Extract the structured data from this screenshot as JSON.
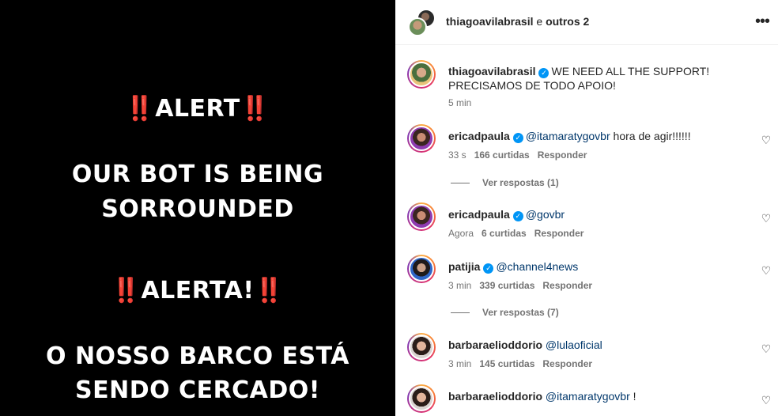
{
  "post_image": {
    "line1": {
      "bang_left": "‼️",
      "text": "ALERT",
      "bang_right": "‼️"
    },
    "line2": "OUR BOT IS BEING",
    "line3": "SORROUNDED",
    "line4": {
      "bang_left": "‼️",
      "text": "ALERTA!",
      "bang_right": "‼️"
    },
    "line5": "O NOSSO BARCO ESTÁ",
    "line6": "SENDO CERCADO!"
  },
  "header": {
    "username": "thiagoavilabrasil",
    "suffix": " e ",
    "others": "outros 2",
    "more_icon": "more-icon"
  },
  "caption": {
    "username": "thiagoavilabrasil",
    "line1": "WE NEED ALL THE SUPPORT!",
    "line2": "PRECISAMOS DE TODO APOIO!",
    "time": "5 min"
  },
  "comments": [
    {
      "username": "ericadpaula",
      "verified": true,
      "mention": "@itamaratygovbr",
      "text": " hora de agir!!!!!!",
      "time": "33 s",
      "likes": "166 curtidas",
      "reply": "Responder",
      "replies": "Ver respostas (1)"
    },
    {
      "username": "ericadpaula",
      "verified": true,
      "mention": "@govbr",
      "text": "",
      "time": "Agora",
      "likes": "6 curtidas",
      "reply": "Responder"
    },
    {
      "username": "patijia",
      "verified": true,
      "mention": "@channel4news",
      "text": "",
      "time": "3 min",
      "likes": "339 curtidas",
      "reply": "Responder",
      "replies": "Ver respostas (7)"
    },
    {
      "username": "barbaraelioddorio",
      "verified": false,
      "mention": "@lulaoficial",
      "text": "",
      "time": "3 min",
      "likes": "145 curtidas",
      "reply": "Responder"
    },
    {
      "username": "barbaraelioddorio",
      "verified": false,
      "mention": "@itamaratygovbr",
      "text": " !"
    }
  ],
  "colors": {
    "alert_red": "#e0201b",
    "verified_blue": "#0095f6",
    "meta_gray": "#737373"
  }
}
